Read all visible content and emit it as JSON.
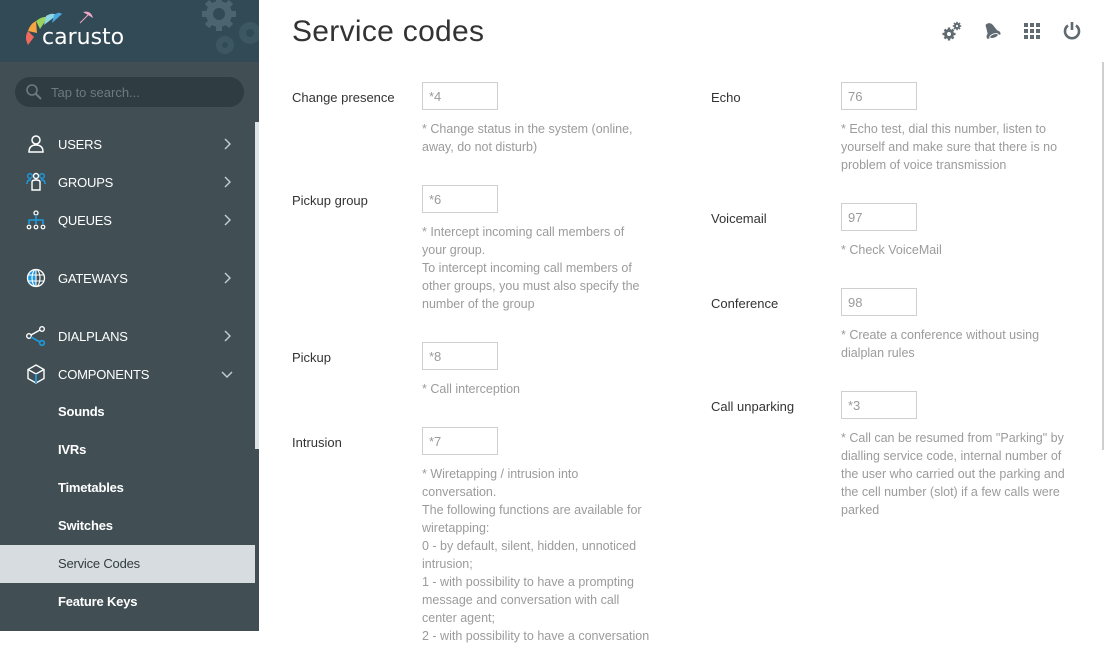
{
  "app": {
    "logo_text": "carusto"
  },
  "search": {
    "placeholder": "Tap to search..."
  },
  "sidebar": {
    "items": [
      {
        "label": "USERS",
        "icon": "user-icon"
      },
      {
        "label": "GROUPS",
        "icon": "group-icon"
      },
      {
        "label": "QUEUES",
        "icon": "queue-icon"
      },
      {
        "label": "GATEWAYS",
        "icon": "globe-icon"
      },
      {
        "label": "DIALPLANS",
        "icon": "share-icon"
      },
      {
        "label": "COMPONENTS",
        "icon": "cube-icon",
        "expanded": true
      }
    ],
    "sub_items": [
      {
        "label": "Sounds"
      },
      {
        "label": "IVRs"
      },
      {
        "label": "Timetables"
      },
      {
        "label": "Switches"
      },
      {
        "label": "Service Codes",
        "active": true
      },
      {
        "label": "Feature Keys"
      }
    ]
  },
  "header": {
    "title": "Service codes",
    "icons": [
      "settings-gears-icon",
      "bell-icon",
      "apps-grid-icon",
      "power-icon"
    ]
  },
  "fields": {
    "left": [
      {
        "label": "Change presence",
        "value": "*4",
        "help": "* Change status in the system (online,\naway, do not disturb)"
      },
      {
        "label": "Pickup group",
        "value": "*6",
        "help": "* Intercept incoming call members of\nyour group.\nTo intercept incoming call members of\nother groups, you must also specify the\nnumber of the group"
      },
      {
        "label": "Pickup",
        "value": "*8",
        "help": "* Call interception"
      },
      {
        "label": "Intrusion",
        "value": "*7",
        "help": "* Wiretapping / intrusion into\nconversation.\nThe following functions are available for\nwiretapping:\n0 - by default, silent, hidden, unnoticed\nintrusion;\n1 - with possibility to have a prompting\nmessage and conversation with call\ncenter agent;\n2 - with possibility to have a conversation"
      }
    ],
    "right": [
      {
        "label": "Echo",
        "value": "76",
        "help": "* Echo test, dial this number, listen to\nyourself and make sure that there is no\nproblem of voice transmission"
      },
      {
        "label": "Voicemail",
        "value": "97",
        "help": "* Check VoiceMail"
      },
      {
        "label": "Conference",
        "value": "98",
        "help": "* Create a conference without using\ndialplan rules"
      },
      {
        "label": "Call unparking",
        "value": "*3",
        "help": "* Call can be resumed from \"Parking\" by\ndialling service code, internal number of\nthe user who carried out the parking and\nthe cell number (slot) if a few calls were\nparked"
      }
    ]
  },
  "colors": {
    "sidebar_bg": "#414f55",
    "sidebar_header_bg": "#324a55",
    "active_item_bg": "#d7dce0",
    "icon_accent": "#1e9be0",
    "top_icon": "#5f6b70"
  }
}
